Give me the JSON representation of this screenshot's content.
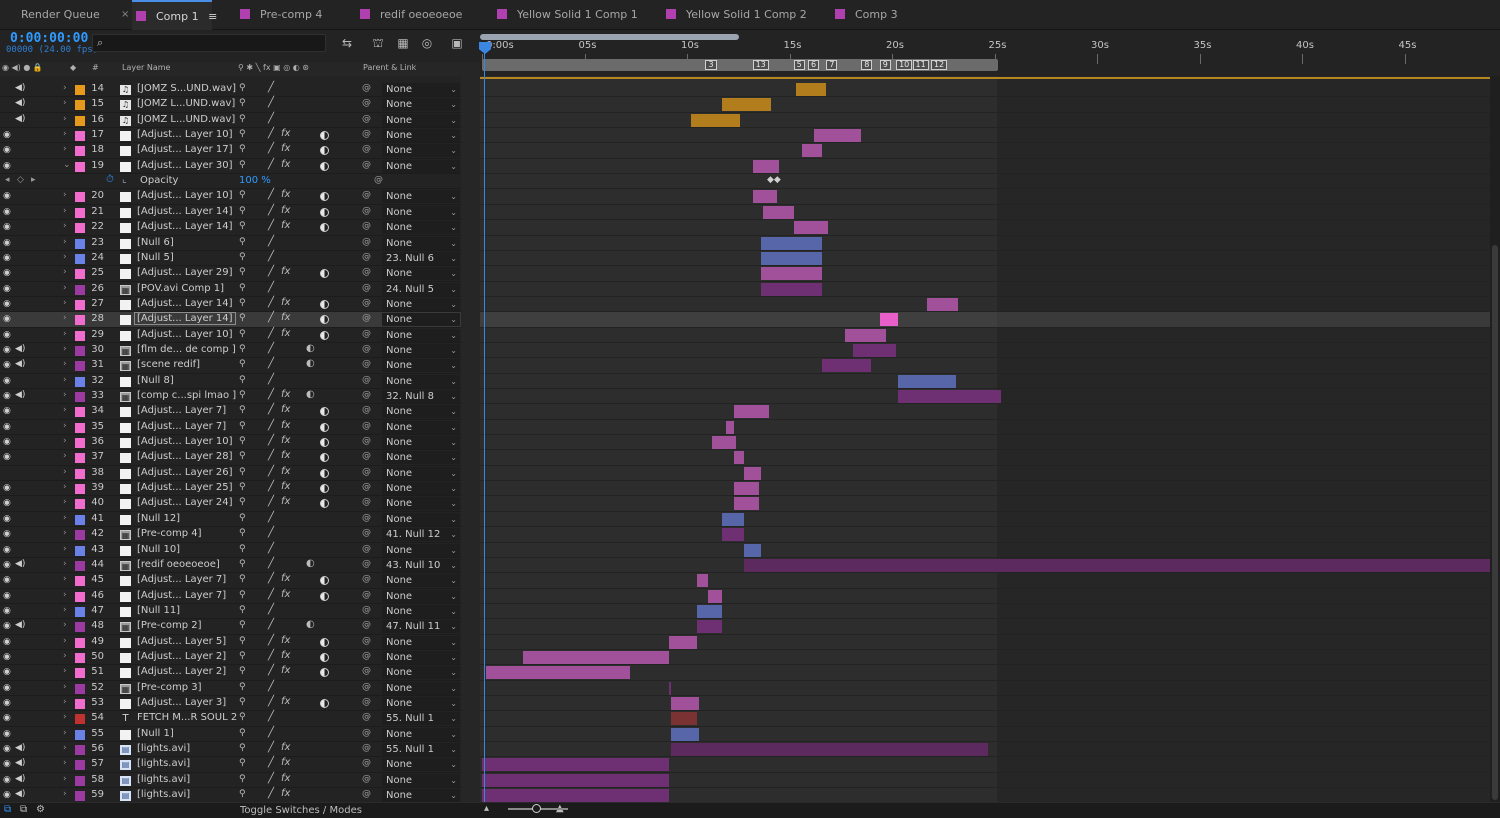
{
  "tabs": [
    {
      "label": "Render Queue",
      "color": "",
      "active": false
    },
    {
      "label": "Comp 1",
      "color": "#b03fb0",
      "active": true
    },
    {
      "label": "Pre-comp 4",
      "color": "#b03fb0",
      "active": false
    },
    {
      "label": "redif oeoeoeoe",
      "color": "#b03fb0",
      "active": false
    },
    {
      "label": "Yellow Solid 1 Comp 1",
      "color": "#b03fb0",
      "active": false
    },
    {
      "label": "Yellow Solid 1 Comp 2",
      "color": "#b03fb0",
      "active": false
    },
    {
      "label": "Comp 3",
      "color": "#b03fb0",
      "active": false
    }
  ],
  "tab_close": "×",
  "tab_menu": "≡",
  "timecode": "0:00:00:00",
  "fps": "00000 (24.00 fps)",
  "search_icon": "search-icon",
  "columns": {
    "layer_name": "Layer Name",
    "number": "#",
    "parent_link": "Parent & Link"
  },
  "ruler_ticks": [
    "0:00s",
    "05s",
    "10s",
    "15s",
    "20s",
    "25s",
    "30s",
    "35s",
    "40s",
    "45s"
  ],
  "markers": [
    "3",
    "13",
    "5",
    "6",
    "7",
    "8",
    "9",
    "10",
    "11",
    "12"
  ],
  "colors": {
    "orange": "#e59a1c",
    "pink": "#f26ccd",
    "purple": "#9b3aa0",
    "blue": "#6a82e8",
    "red": "#c03232",
    "white": "#f2f2f2"
  },
  "layers": [
    {
      "num": "14",
      "name": "[JOMZ S...UND.wav]",
      "label": "orange",
      "type": "audio",
      "audio": true,
      "eye": false,
      "fx": false,
      "adj": false,
      "parent": "None",
      "bar": [
        15.3,
        16.8
      ],
      "barcolor": "#b27d1c"
    },
    {
      "num": "15",
      "name": "[JOMZ L...UND.wav]",
      "label": "orange",
      "type": "audio",
      "audio": true,
      "eye": false,
      "fx": false,
      "adj": false,
      "parent": "None",
      "bar": [
        11.7,
        14.1
      ],
      "barcolor": "#b27d1c"
    },
    {
      "num": "16",
      "name": "[JOMZ L...UND.wav]",
      "label": "orange",
      "type": "audio",
      "audio": true,
      "eye": false,
      "fx": false,
      "adj": false,
      "parent": "None",
      "bar": [
        10.2,
        12.6
      ],
      "barcolor": "#b27d1c"
    },
    {
      "num": "17",
      "name": "[Adjust... Layer 10]",
      "label": "pink",
      "type": "solid",
      "audio": false,
      "eye": true,
      "fx": true,
      "adj": true,
      "parent": "None",
      "bar": [
        16.2,
        18.5
      ],
      "barcolor": "#a0519a"
    },
    {
      "num": "18",
      "name": "[Adjust... Layer 17]",
      "label": "pink",
      "type": "solid",
      "audio": false,
      "eye": true,
      "fx": true,
      "adj": true,
      "parent": "None",
      "bar": [
        15.6,
        16.6
      ],
      "barcolor": "#a0519a"
    },
    {
      "num": "19",
      "name": "[Adjust... Layer 30]",
      "label": "pink",
      "type": "solid",
      "audio": false,
      "eye": true,
      "fx": true,
      "adj": true,
      "parent": "None",
      "bar": [
        13.2,
        14.5
      ],
      "barcolor": "#a0519a",
      "expanded": true
    },
    {
      "num": "20",
      "name": "[Adjust... Layer 10]",
      "label": "pink",
      "type": "solid",
      "audio": false,
      "eye": true,
      "fx": true,
      "adj": true,
      "parent": "None",
      "bar": [
        13.2,
        14.4
      ],
      "barcolor": "#a0519a"
    },
    {
      "num": "21",
      "name": "[Adjust... Layer 14]",
      "label": "pink",
      "type": "solid",
      "audio": false,
      "eye": true,
      "fx": true,
      "adj": true,
      "parent": "None",
      "bar": [
        13.7,
        15.2
      ],
      "barcolor": "#a0519a"
    },
    {
      "num": "22",
      "name": "[Adjust... Layer 14]",
      "label": "pink",
      "type": "solid",
      "audio": false,
      "eye": true,
      "fx": true,
      "adj": true,
      "parent": "None",
      "bar": [
        15.2,
        16.9
      ],
      "barcolor": "#a0519a"
    },
    {
      "num": "23",
      "name": "[Null 6]",
      "label": "blue",
      "type": "solid",
      "audio": false,
      "eye": true,
      "fx": false,
      "adj": false,
      "parent": "None",
      "bar": [
        13.6,
        16.6
      ],
      "barcolor": "#5666a8"
    },
    {
      "num": "24",
      "name": "[Null 5]",
      "label": "blue",
      "type": "solid",
      "audio": false,
      "eye": true,
      "fx": false,
      "adj": false,
      "parent": "23. Null 6",
      "bar": [
        13.6,
        16.6
      ],
      "barcolor": "#5666a8"
    },
    {
      "num": "25",
      "name": "[Adjust... Layer 29]",
      "label": "pink",
      "type": "solid",
      "audio": false,
      "eye": true,
      "fx": true,
      "adj": true,
      "parent": "None",
      "bar": [
        13.6,
        16.6
      ],
      "barcolor": "#a0519a"
    },
    {
      "num": "26",
      "name": "[POV.avi Comp 1]",
      "label": "purple",
      "type": "comp",
      "audio": false,
      "eye": true,
      "fx": false,
      "adj": false,
      "parent": "24. Null 5",
      "bar": [
        13.6,
        16.6
      ],
      "barcolor": "#6e2f73"
    },
    {
      "num": "27",
      "name": "[Adjust... Layer 14]",
      "label": "pink",
      "type": "solid",
      "audio": false,
      "eye": true,
      "fx": true,
      "adj": true,
      "parent": "None",
      "bar": [
        21.7,
        23.2
      ],
      "barcolor": "#a0519a"
    },
    {
      "num": "28",
      "name": "[Adjust... Layer 14]",
      "label": "pink",
      "type": "solid",
      "audio": false,
      "eye": true,
      "fx": true,
      "adj": true,
      "parent": "None",
      "bar": [
        19.4,
        20.3
      ],
      "barcolor": "#e85fc9",
      "selected": true
    },
    {
      "num": "29",
      "name": "[Adjust... Layer 10]",
      "label": "pink",
      "type": "solid",
      "audio": false,
      "eye": true,
      "fx": true,
      "adj": true,
      "parent": "None",
      "bar": [
        17.7,
        19.7
      ],
      "barcolor": "#a0519a"
    },
    {
      "num": "30",
      "name": "[flm de... de comp ]",
      "label": "purple",
      "type": "comp",
      "audio": true,
      "eye": true,
      "fx": false,
      "adj": false,
      "parent": "None",
      "bar": [
        18.1,
        20.2
      ],
      "barcolor": "#6e2f73"
    },
    {
      "num": "31",
      "name": "[scene redif]",
      "label": "purple",
      "type": "comp",
      "audio": true,
      "eye": true,
      "fx": false,
      "adj": false,
      "parent": "None",
      "bar": [
        16.6,
        19.0
      ],
      "barcolor": "#6e2f73"
    },
    {
      "num": "32",
      "name": "[Null 8]",
      "label": "blue",
      "type": "solid",
      "audio": false,
      "eye": true,
      "fx": false,
      "adj": false,
      "parent": "None",
      "bar": [
        20.3,
        23.1
      ],
      "barcolor": "#5666a8"
    },
    {
      "num": "33",
      "name": "[comp c...spi lmao ]",
      "label": "purple",
      "type": "comp",
      "audio": true,
      "eye": true,
      "fx": true,
      "adj": false,
      "parent": "32. Null 8",
      "bar": [
        20.3,
        25.3
      ],
      "barcolor": "#6e2f73"
    },
    {
      "num": "34",
      "name": "[Adjust... Layer 7]",
      "label": "pink",
      "type": "solid",
      "audio": false,
      "eye": true,
      "fx": true,
      "adj": true,
      "parent": "None",
      "bar": [
        12.3,
        14.0
      ],
      "barcolor": "#a0519a"
    },
    {
      "num": "35",
      "name": "[Adjust... Layer 7]",
      "label": "pink",
      "type": "solid",
      "audio": false,
      "eye": true,
      "fx": true,
      "adj": true,
      "parent": "None",
      "bar": [
        11.9,
        12.3
      ],
      "barcolor": "#a0519a"
    },
    {
      "num": "36",
      "name": "[Adjust... Layer 10]",
      "label": "pink",
      "type": "solid",
      "audio": false,
      "eye": true,
      "fx": true,
      "adj": true,
      "parent": "None",
      "bar": [
        11.2,
        12.4
      ],
      "barcolor": "#a0519a"
    },
    {
      "num": "37",
      "name": "[Adjust... Layer 28]",
      "label": "pink",
      "type": "solid",
      "audio": false,
      "eye": true,
      "fx": true,
      "adj": true,
      "parent": "None",
      "bar": [
        12.3,
        12.8
      ],
      "barcolor": "#a0519a"
    },
    {
      "num": "38",
      "name": "[Adjust... Layer 26]",
      "label": "pink",
      "type": "solid",
      "audio": false,
      "eye": false,
      "fx": true,
      "adj": true,
      "parent": "None",
      "bar": [
        12.8,
        13.6
      ],
      "barcolor": "#a0519a"
    },
    {
      "num": "39",
      "name": "[Adjust... Layer 25]",
      "label": "pink",
      "type": "solid",
      "audio": false,
      "eye": true,
      "fx": true,
      "adj": true,
      "parent": "None",
      "bar": [
        12.3,
        13.5
      ],
      "barcolor": "#a0519a"
    },
    {
      "num": "40",
      "name": "[Adjust... Layer 24]",
      "label": "pink",
      "type": "solid",
      "audio": false,
      "eye": true,
      "fx": true,
      "adj": true,
      "parent": "None",
      "bar": [
        12.3,
        13.5
      ],
      "barcolor": "#a0519a"
    },
    {
      "num": "41",
      "name": "[Null 12]",
      "label": "blue",
      "type": "solid",
      "audio": false,
      "eye": true,
      "fx": false,
      "adj": false,
      "parent": "None",
      "bar": [
        11.7,
        12.8
      ],
      "barcolor": "#5666a8"
    },
    {
      "num": "42",
      "name": "[Pre-comp 4]",
      "label": "purple",
      "type": "comp",
      "audio": false,
      "eye": true,
      "fx": false,
      "adj": false,
      "parent": "41. Null 12",
      "bar": [
        11.7,
        12.8
      ],
      "barcolor": "#6e2f73"
    },
    {
      "num": "43",
      "name": "[Null 10]",
      "label": "blue",
      "type": "solid",
      "audio": false,
      "eye": true,
      "fx": false,
      "adj": false,
      "parent": "None",
      "bar": [
        12.8,
        13.6
      ],
      "barcolor": "#5666a8"
    },
    {
      "num": "44",
      "name": "[redif oeoeoeoe]",
      "label": "purple",
      "type": "comp",
      "audio": true,
      "eye": true,
      "fx": false,
      "adj": false,
      "parent": "43. Null 10",
      "bar": [
        12.8,
        49.3
      ],
      "barcolor": "#5c2a5f"
    },
    {
      "num": "45",
      "name": "[Adjust... Layer 7]",
      "label": "pink",
      "type": "solid",
      "audio": false,
      "eye": true,
      "fx": true,
      "adj": true,
      "parent": "None",
      "bar": [
        10.5,
        11.0
      ],
      "barcolor": "#a0519a"
    },
    {
      "num": "46",
      "name": "[Adjust... Layer 7]",
      "label": "pink",
      "type": "solid",
      "audio": false,
      "eye": true,
      "fx": true,
      "adj": true,
      "parent": "None",
      "bar": [
        11.0,
        11.7
      ],
      "barcolor": "#a0519a"
    },
    {
      "num": "47",
      "name": "[Null 11]",
      "label": "blue",
      "type": "solid",
      "audio": false,
      "eye": true,
      "fx": false,
      "adj": false,
      "parent": "None",
      "bar": [
        10.5,
        11.7
      ],
      "barcolor": "#5666a8"
    },
    {
      "num": "48",
      "name": "[Pre-comp 2]",
      "label": "purple",
      "type": "comp",
      "audio": true,
      "eye": true,
      "fx": false,
      "adj": false,
      "parent": "47. Null 11",
      "bar": [
        10.5,
        11.7
      ],
      "barcolor": "#6e2f73"
    },
    {
      "num": "49",
      "name": "[Adjust... Layer 5]",
      "label": "pink",
      "type": "solid",
      "audio": false,
      "eye": true,
      "fx": true,
      "adj": true,
      "parent": "None",
      "bar": [
        9.1,
        10.5
      ],
      "barcolor": "#a0519a"
    },
    {
      "num": "50",
      "name": "[Adjust... Layer 2]",
      "label": "pink",
      "type": "solid",
      "audio": false,
      "eye": true,
      "fx": true,
      "adj": true,
      "parent": "None",
      "bar": [
        2.0,
        9.1
      ],
      "barcolor": "#a0519a"
    },
    {
      "num": "51",
      "name": "[Adjust... Layer 2]",
      "label": "pink",
      "type": "solid",
      "audio": false,
      "eye": true,
      "fx": true,
      "adj": true,
      "parent": "None",
      "bar": [
        0.2,
        7.2
      ],
      "barcolor": "#a0519a"
    },
    {
      "num": "52",
      "name": "[Pre-comp 3]",
      "label": "purple",
      "type": "comp",
      "audio": false,
      "eye": true,
      "fx": false,
      "adj": false,
      "parent": "None",
      "bar": [
        9.1,
        9.2
      ],
      "barcolor": "#6e2f73"
    },
    {
      "num": "53",
      "name": "[Adjust... Layer 3]",
      "label": "pink",
      "type": "solid",
      "audio": false,
      "eye": true,
      "fx": true,
      "adj": true,
      "parent": "None",
      "bar": [
        9.2,
        10.6
      ],
      "barcolor": "#a0519a"
    },
    {
      "num": "54",
      "name": "FETCH M...R SOUL 2",
      "label": "red",
      "type": "text",
      "audio": false,
      "eye": true,
      "fx": false,
      "adj": false,
      "parent": "55. Null 1",
      "bar": [
        9.2,
        10.5
      ],
      "barcolor": "#7a3232"
    },
    {
      "num": "55",
      "name": "[Null 1]",
      "label": "blue",
      "type": "solid",
      "audio": false,
      "eye": true,
      "fx": false,
      "adj": false,
      "parent": "None",
      "bar": [
        9.2,
        10.6
      ],
      "barcolor": "#5666a8"
    },
    {
      "num": "56",
      "name": "[lights.avi]",
      "label": "purple",
      "type": "footage",
      "audio": true,
      "eye": true,
      "fx": true,
      "adj": false,
      "parent": "55. Null 1",
      "bar": [
        9.2,
        24.7
      ],
      "barcolor": "#5c2a5f"
    },
    {
      "num": "57",
      "name": "[lights.avi]",
      "label": "purple",
      "type": "footage",
      "audio": true,
      "eye": true,
      "fx": true,
      "adj": false,
      "parent": "None",
      "bar": [
        0.0,
        9.1
      ],
      "barcolor": "#6e2f73"
    },
    {
      "num": "58",
      "name": "[lights.avi]",
      "label": "purple",
      "type": "footage",
      "audio": true,
      "eye": true,
      "fx": true,
      "adj": false,
      "parent": "None",
      "bar": [
        0.0,
        9.1
      ],
      "barcolor": "#6e2f73"
    },
    {
      "num": "59",
      "name": "[lights.avi]",
      "label": "purple",
      "type": "footage",
      "audio": true,
      "eye": true,
      "fx": true,
      "adj": false,
      "parent": "None",
      "bar": [
        0.0,
        9.1
      ],
      "barcolor": "#6e2f73"
    }
  ],
  "property": {
    "name": "Opacity",
    "value": "100 %"
  },
  "footer": {
    "toggle": "Toggle Switches / Modes"
  }
}
